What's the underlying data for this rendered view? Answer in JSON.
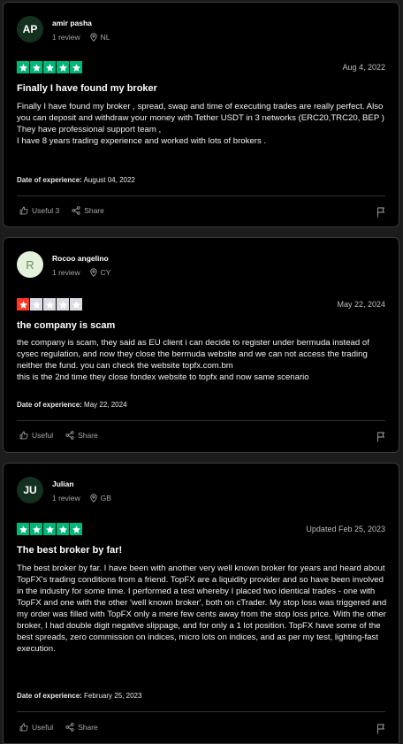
{
  "colors": {
    "star_green": "#00b67a",
    "star_red": "#ff3722",
    "star_empty": "#dcdce6",
    "avatar_dark": "#14301f",
    "avatar_light": "#e4f2dc"
  },
  "reviews": [
    {
      "initials": "AP",
      "name": "amir pasha",
      "review_count": "1 review",
      "country": "NL",
      "rating": 5,
      "date": "Aug 4, 2022",
      "title": "Finally I have found my broker",
      "body": [
        "Finally I have found my broker , spread, swap and time of executing trades are really perfect. Also you can deposit and withdraw your money with Tether USDT in 3 networks (ERC20,TRC20, BEP )",
        "They have professional support team ,",
        "I have 8 years trading experience and worked with lots of brokers ."
      ],
      "experience_label": "Date of experience:",
      "experience_date": "August 04, 2022",
      "useful_label": "Useful 3",
      "share_label": "Share"
    },
    {
      "initials": "R",
      "name": "Rocoo angelino",
      "review_count": "1 review",
      "country": "CY",
      "rating": 1,
      "date": "May 22, 2024",
      "title": "the company is scam",
      "body": [
        "the company is scam, they said as EU client i can decide to register under bermuda instead of cysec regulation, and now they close the bermuda website and we can not access the trading neither the fund. you can check the website topfx.com.bm",
        "this is the 2nd time they close fondex website to topfx and now same scenario"
      ],
      "experience_label": "Date of experience:",
      "experience_date": "May 22, 2024",
      "useful_label": "Useful",
      "share_label": "Share"
    },
    {
      "initials": "JU",
      "name": "Julian",
      "review_count": "1 review",
      "country": "GB",
      "rating": 5,
      "date": "Updated Feb 25, 2023",
      "title": "The best broker by far!",
      "body": [
        "The best broker by far. I have been with another very well known broker for years and heard about TopFX's trading conditions from a friend. TopFX are a liquidity provider and so have been involved in the industry for some time. I performed a test whereby I placed two identical trades - one with TopFX and one with the other 'well known broker', both on cTrader. My stop loss was triggered and my order was filled with TopFX only a mere few cents away from the stop loss price. With the other broker, I had double digit negative slippage, and for only a 1 lot position. TopFX have some of the best spreads, zero commission on indices, micro lots on indices, and as per my test, lighting-fast execution."
      ],
      "experience_label": "Date of experience:",
      "experience_date": "February 25, 2023",
      "useful_label": "Useful",
      "share_label": "Share"
    }
  ]
}
